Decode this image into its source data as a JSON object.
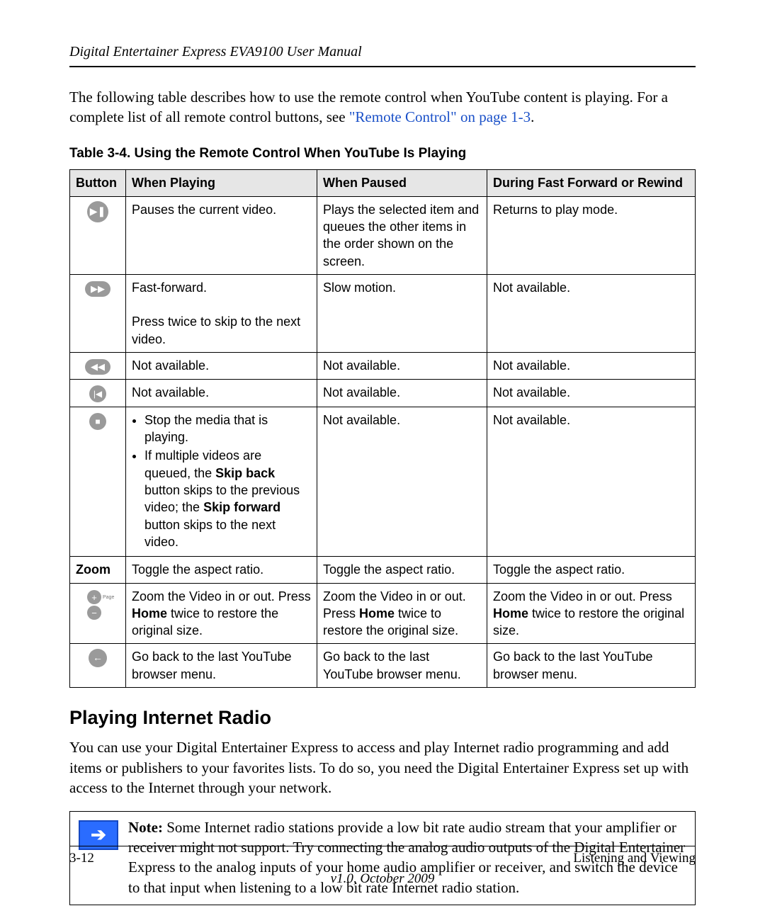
{
  "header": {
    "title": "Digital Entertainer Express EVA9100 User Manual"
  },
  "intro": {
    "text_before_link": "The following table describes how to use the remote control when YouTube content is playing. For a complete list of all remote control buttons, see ",
    "link_text": "\"Remote Control\" on page 1-3",
    "text_after_link": "."
  },
  "table": {
    "caption": "Table 3-4.  Using the Remote Control When YouTube Is Playing",
    "headers": {
      "button": "Button",
      "playing": "When Playing",
      "paused": "When Paused",
      "ffrw": "During Fast Forward or Rewind"
    },
    "rows": {
      "play_pause": {
        "icon_name": "play-pause-icon",
        "playing": "Pauses the current video.",
        "paused": "Plays the selected item and queues the other items in the order shown on the screen.",
        "ffrw": "Returns to play mode."
      },
      "fast_forward": {
        "icon_name": "fast-forward-icon",
        "playing_line1": "Fast-forward.",
        "playing_line2": "Press twice to skip to the next video.",
        "paused": "Slow motion.",
        "ffrw": "Not available."
      },
      "rewind": {
        "icon_name": "rewind-icon",
        "playing": "Not available.",
        "paused": "Not available.",
        "ffrw": "Not available."
      },
      "skip_back": {
        "icon_name": "skip-back-icon",
        "playing": "Not available.",
        "paused": "Not available.",
        "ffrw": "Not available."
      },
      "stop": {
        "icon_name": "stop-icon",
        "bullets": {
          "b1": "Stop the media that is playing.",
          "b2_pre": "If multiple videos are queued, the ",
          "b2_skip_back": "Skip back",
          "b2_mid": " button skips to the previous video; the ",
          "b2_skip_fwd": "Skip forward",
          "b2_post": " button skips to the next video."
        },
        "paused": "Not available.",
        "ffrw": "Not available."
      },
      "zoom": {
        "label": "Zoom",
        "playing": "Toggle the aspect ratio.",
        "paused": "Toggle the aspect ratio.",
        "ffrw": "Toggle the aspect ratio."
      },
      "zoom_inout": {
        "icon_name": "zoom-in-out-icon",
        "playing_pre": "Zoom the Video in or out. Press ",
        "playing_home": "Home",
        "playing_post": " twice to restore the original size.",
        "paused_pre": "Zoom the Video in or out. Press ",
        "paused_home": "Home",
        "paused_post": " twice to restore the original size.",
        "ffrw_pre": "Zoom the Video in or out. Press ",
        "ffrw_home": "Home",
        "ffrw_post": " twice to restore the original size."
      },
      "back": {
        "icon_name": "back-icon",
        "playing": "Go back to the last YouTube browser menu.",
        "paused": "Go back to the last YouTube browser menu.",
        "ffrw": "Go back to the last YouTube browser menu."
      }
    }
  },
  "section": {
    "heading": "Playing Internet Radio",
    "body": "You can use your Digital Entertainer Express to access and play Internet radio programming and add items or publishers to your favorites lists. To do so, you need the Digital Entertainer Express set up with access to the Internet through your network."
  },
  "note": {
    "label": "Note:",
    "body": " Some Internet radio stations provide a low bit rate audio stream that your amplifier or receiver might not support. Try connecting the analog audio outputs of the Digital Entertainer Express to the analog inputs of your home audio amplifier or receiver, and switch the device to that input when listening to a low bit rate Internet radio station."
  },
  "footer": {
    "page_number": "3-12",
    "section_title": "Listening and Viewing",
    "version": "v1.0, October 2009"
  }
}
